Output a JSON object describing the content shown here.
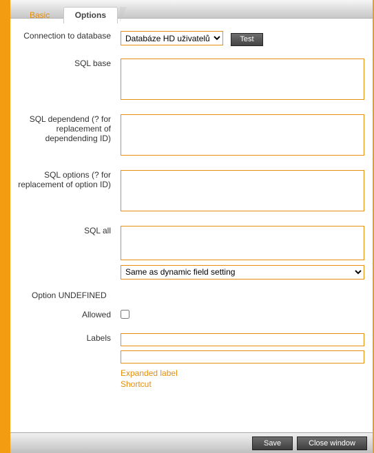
{
  "tabs": {
    "basic": "Basic",
    "options": "Options"
  },
  "labels": {
    "connection": "Connection to database",
    "sql_base": "SQL base",
    "sql_dependend": "SQL dependend (? for replacement of dependending ID)",
    "sql_options": "SQL options (? for replacement of option ID)",
    "sql_all": "SQL all",
    "section_undefined": "Option UNDEFINED",
    "allowed": "Allowed",
    "labels_field": "Labels"
  },
  "fields": {
    "connection_selected": "Databáze HD uživatelů",
    "sql_base": "",
    "sql_dependend": "",
    "sql_options": "",
    "sql_all": "",
    "sql_all_mode": "Same as dynamic field setting",
    "label1": "",
    "label2": ""
  },
  "buttons": {
    "test": "Test",
    "save": "Save",
    "close": "Close window"
  },
  "links": {
    "expanded": "Expanded label",
    "shortcut": "Shortcut"
  }
}
